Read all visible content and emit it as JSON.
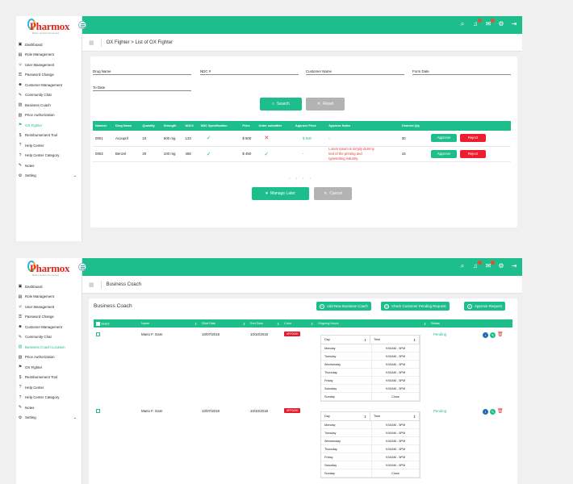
{
  "brand": {
    "name": "Pharmox",
    "tagline": "Better Health Connected"
  },
  "screen1": {
    "breadcrumb": "OX Fighter > List of OX Fighter",
    "menu": [
      {
        "label": "Dashboard",
        "icon": "dashboard-icon"
      },
      {
        "label": "Role Management",
        "icon": "role-icon"
      },
      {
        "label": "User Management",
        "icon": "users-icon"
      },
      {
        "label": "Password Change",
        "icon": "lock-icon"
      },
      {
        "label": "Customer Management",
        "icon": "customer-icon"
      },
      {
        "label": "Community Chat",
        "icon": "chat-icon"
      },
      {
        "label": "Business Coach",
        "icon": "coach-icon"
      },
      {
        "label": "Price Authorization",
        "icon": "price-icon"
      },
      {
        "label": "OX Fighter",
        "icon": "fighter-icon",
        "active": true
      },
      {
        "label": "Reimbursement Tool",
        "icon": "reimbursement-icon"
      },
      {
        "label": "Help Center",
        "icon": "help-icon"
      },
      {
        "label": "Help Center Category",
        "icon": "help-category-icon"
      },
      {
        "label": "Notes",
        "icon": "notes-icon"
      },
      {
        "label": "Setting",
        "icon": "gear-icon",
        "has_chevron": true
      }
    ],
    "filters": {
      "drug_name": "Drug Name",
      "ndc": "NDC #",
      "customer_name": "Customer Name",
      "form_date": "Form Date",
      "to_date": "To Date"
    },
    "search_label": "Search",
    "reset_label": "Reset",
    "table": {
      "headers": [
        "Number",
        "Drug Name",
        "Quantity",
        "Strength",
        "NDC#",
        "NDC Specification",
        "Price",
        "Order submitter",
        "Approve Price",
        "Approve Notes",
        "Ordered Qty"
      ],
      "rows": [
        {
          "number": "0001",
          "drug": "Acoupril",
          "qty": "10",
          "strength": "500 mg",
          "ndc": "133",
          "spec": "check",
          "price": "$ 500",
          "order": "cross",
          "approve_price": "$ 500",
          "notes": "-",
          "ordered": "30"
        },
        {
          "number": "0002",
          "drug": "Benzel",
          "qty": "20",
          "strength": "100 mg",
          "ndc": "456",
          "spec": "check",
          "price": "$ 450",
          "order": "check",
          "approve_price": "-",
          "notes": "Lorem Ipsum is simply dummy text of the printing and typesetting industry.",
          "ordered": "15"
        }
      ],
      "approve_label": "Approve",
      "reject_label": "Reject"
    },
    "pager": "• • • •",
    "manage_later_label": "Manage Later",
    "cancel_label": "Cancel"
  },
  "screen2": {
    "breadcrumb": "Business Coach",
    "menu": [
      {
        "label": "Dashboard",
        "icon": "dashboard-icon"
      },
      {
        "label": "Role Management",
        "icon": "role-icon"
      },
      {
        "label": "User Management",
        "icon": "users-icon"
      },
      {
        "label": "Password Change",
        "icon": "lock-icon"
      },
      {
        "label": "Customer Management",
        "icon": "customer-icon"
      },
      {
        "label": "Community Chat",
        "icon": "chat-icon"
      },
      {
        "label": "Business Coach Location",
        "icon": "coach-icon",
        "active": true
      },
      {
        "label": "Price Authorization",
        "icon": "price-icon"
      },
      {
        "label": "OX Fighter",
        "icon": "fighter-icon"
      },
      {
        "label": "Reimbursement Tool",
        "icon": "reimbursement-icon"
      },
      {
        "label": "Help Center",
        "icon": "help-icon"
      },
      {
        "label": "Help Center Category",
        "icon": "help-category-icon"
      },
      {
        "label": "Notes",
        "icon": "notes-icon"
      },
      {
        "label": "Setting",
        "icon": "gear-icon",
        "has_chevron": true
      }
    ],
    "title": "Business Coach",
    "buttons": {
      "add": "Add New Business Coach",
      "check": "Check Customer Pending Request",
      "approve": "Approve Request"
    },
    "headers": [
      "Select",
      "Name",
      "Start Date",
      "End Date",
      "Color",
      "Ongoing Hours",
      "Status"
    ],
    "rows": [
      {
        "name": "Mario F. Gam",
        "start": "10/07/2018",
        "end": "10/10/2018",
        "color": "#FF0000",
        "status": "Pending"
      },
      {
        "name": "Mario F. Gam",
        "start": "10/07/2018",
        "end": "10/10/2018",
        "color": "#FF0000",
        "status": "Pending"
      }
    ],
    "hours": {
      "day_label": "Day",
      "time_label": "Time",
      "days": [
        {
          "day": "Monday",
          "time": "9:00AM - 5PM"
        },
        {
          "day": "Tuesday",
          "time": "9:00AM - 5PM"
        },
        {
          "day": "Wednesday",
          "time": "9:00AM - 5PM"
        },
        {
          "day": "Thursday",
          "time": "9:00AM - 5PM"
        },
        {
          "day": "Friday",
          "time": "9:00AM - 5PM"
        },
        {
          "day": "Saturday",
          "time": "9:00AM - 5PM"
        },
        {
          "day": "Sunday",
          "time": "Close"
        }
      ]
    }
  },
  "colors": {
    "accent": "#1dbe8b",
    "danger": "#ee1c2f",
    "grey": "#b3b3b3"
  }
}
